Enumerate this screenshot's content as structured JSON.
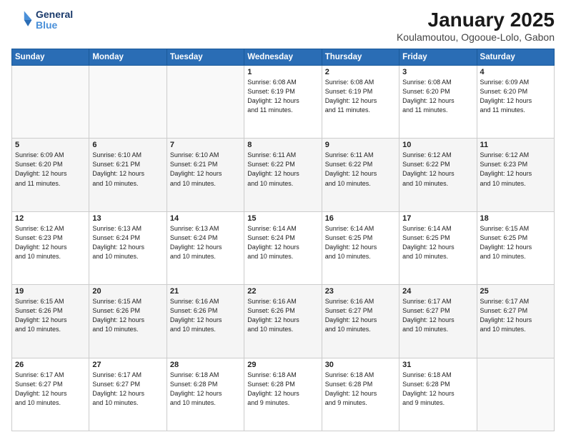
{
  "header": {
    "logo_line1": "General",
    "logo_line2": "Blue",
    "title": "January 2025",
    "subtitle": "Koulamoutou, Ogooue-Lolo, Gabon"
  },
  "days_of_week": [
    "Sunday",
    "Monday",
    "Tuesday",
    "Wednesday",
    "Thursday",
    "Friday",
    "Saturday"
  ],
  "weeks": [
    [
      {
        "num": "",
        "info": ""
      },
      {
        "num": "",
        "info": ""
      },
      {
        "num": "",
        "info": ""
      },
      {
        "num": "1",
        "info": "Sunrise: 6:08 AM\nSunset: 6:19 PM\nDaylight: 12 hours\nand 11 minutes."
      },
      {
        "num": "2",
        "info": "Sunrise: 6:08 AM\nSunset: 6:19 PM\nDaylight: 12 hours\nand 11 minutes."
      },
      {
        "num": "3",
        "info": "Sunrise: 6:08 AM\nSunset: 6:20 PM\nDaylight: 12 hours\nand 11 minutes."
      },
      {
        "num": "4",
        "info": "Sunrise: 6:09 AM\nSunset: 6:20 PM\nDaylight: 12 hours\nand 11 minutes."
      }
    ],
    [
      {
        "num": "5",
        "info": "Sunrise: 6:09 AM\nSunset: 6:20 PM\nDaylight: 12 hours\nand 11 minutes."
      },
      {
        "num": "6",
        "info": "Sunrise: 6:10 AM\nSunset: 6:21 PM\nDaylight: 12 hours\nand 10 minutes."
      },
      {
        "num": "7",
        "info": "Sunrise: 6:10 AM\nSunset: 6:21 PM\nDaylight: 12 hours\nand 10 minutes."
      },
      {
        "num": "8",
        "info": "Sunrise: 6:11 AM\nSunset: 6:22 PM\nDaylight: 12 hours\nand 10 minutes."
      },
      {
        "num": "9",
        "info": "Sunrise: 6:11 AM\nSunset: 6:22 PM\nDaylight: 12 hours\nand 10 minutes."
      },
      {
        "num": "10",
        "info": "Sunrise: 6:12 AM\nSunset: 6:22 PM\nDaylight: 12 hours\nand 10 minutes."
      },
      {
        "num": "11",
        "info": "Sunrise: 6:12 AM\nSunset: 6:23 PM\nDaylight: 12 hours\nand 10 minutes."
      }
    ],
    [
      {
        "num": "12",
        "info": "Sunrise: 6:12 AM\nSunset: 6:23 PM\nDaylight: 12 hours\nand 10 minutes."
      },
      {
        "num": "13",
        "info": "Sunrise: 6:13 AM\nSunset: 6:24 PM\nDaylight: 12 hours\nand 10 minutes."
      },
      {
        "num": "14",
        "info": "Sunrise: 6:13 AM\nSunset: 6:24 PM\nDaylight: 12 hours\nand 10 minutes."
      },
      {
        "num": "15",
        "info": "Sunrise: 6:14 AM\nSunset: 6:24 PM\nDaylight: 12 hours\nand 10 minutes."
      },
      {
        "num": "16",
        "info": "Sunrise: 6:14 AM\nSunset: 6:25 PM\nDaylight: 12 hours\nand 10 minutes."
      },
      {
        "num": "17",
        "info": "Sunrise: 6:14 AM\nSunset: 6:25 PM\nDaylight: 12 hours\nand 10 minutes."
      },
      {
        "num": "18",
        "info": "Sunrise: 6:15 AM\nSunset: 6:25 PM\nDaylight: 12 hours\nand 10 minutes."
      }
    ],
    [
      {
        "num": "19",
        "info": "Sunrise: 6:15 AM\nSunset: 6:26 PM\nDaylight: 12 hours\nand 10 minutes."
      },
      {
        "num": "20",
        "info": "Sunrise: 6:15 AM\nSunset: 6:26 PM\nDaylight: 12 hours\nand 10 minutes."
      },
      {
        "num": "21",
        "info": "Sunrise: 6:16 AM\nSunset: 6:26 PM\nDaylight: 12 hours\nand 10 minutes."
      },
      {
        "num": "22",
        "info": "Sunrise: 6:16 AM\nSunset: 6:26 PM\nDaylight: 12 hours\nand 10 minutes."
      },
      {
        "num": "23",
        "info": "Sunrise: 6:16 AM\nSunset: 6:27 PM\nDaylight: 12 hours\nand 10 minutes."
      },
      {
        "num": "24",
        "info": "Sunrise: 6:17 AM\nSunset: 6:27 PM\nDaylight: 12 hours\nand 10 minutes."
      },
      {
        "num": "25",
        "info": "Sunrise: 6:17 AM\nSunset: 6:27 PM\nDaylight: 12 hours\nand 10 minutes."
      }
    ],
    [
      {
        "num": "26",
        "info": "Sunrise: 6:17 AM\nSunset: 6:27 PM\nDaylight: 12 hours\nand 10 minutes."
      },
      {
        "num": "27",
        "info": "Sunrise: 6:17 AM\nSunset: 6:27 PM\nDaylight: 12 hours\nand 10 minutes."
      },
      {
        "num": "28",
        "info": "Sunrise: 6:18 AM\nSunset: 6:28 PM\nDaylight: 12 hours\nand 10 minutes."
      },
      {
        "num": "29",
        "info": "Sunrise: 6:18 AM\nSunset: 6:28 PM\nDaylight: 12 hours\nand 9 minutes."
      },
      {
        "num": "30",
        "info": "Sunrise: 6:18 AM\nSunset: 6:28 PM\nDaylight: 12 hours\nand 9 minutes."
      },
      {
        "num": "31",
        "info": "Sunrise: 6:18 AM\nSunset: 6:28 PM\nDaylight: 12 hours\nand 9 minutes."
      },
      {
        "num": "",
        "info": ""
      }
    ]
  ]
}
